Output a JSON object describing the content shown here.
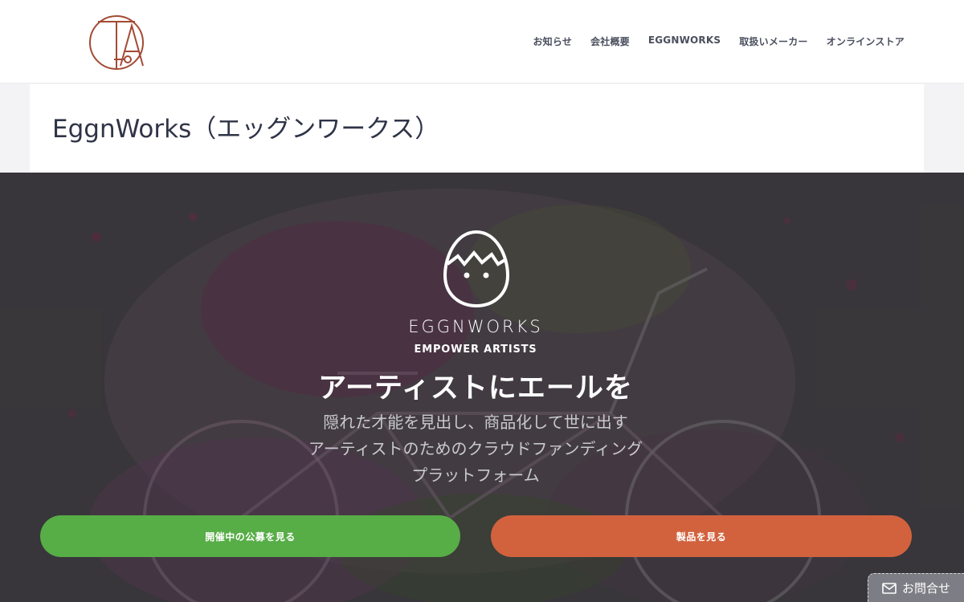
{
  "header": {
    "logo_icon": "ta-monogram-logo",
    "logo_color": "#a34a34",
    "nav": [
      {
        "label": "お知らせ"
      },
      {
        "label": "会社概要"
      },
      {
        "label": "EGGNWORKS"
      },
      {
        "label": "取扱いメーカー"
      },
      {
        "label": "オンラインストア"
      }
    ]
  },
  "page": {
    "title": "EggnWorks（エッグンワークス）"
  },
  "hero": {
    "background_icon": "watercolor-bicycle-image",
    "brand_icon": "cracked-egg-face-icon",
    "brand_name": "EGGNWORKS",
    "tagline": "EMPOWER ARTISTS",
    "heading": "アーティストにエールを",
    "description": [
      "隠れた才能を見出し、商品化して世に出す",
      "アーティストのためのクラウドファンディング",
      "プラットフォーム"
    ],
    "buttons": [
      {
        "label": "開催中の公募を見る",
        "color": "#57ad46"
      },
      {
        "label": "製品を見る",
        "color": "#d2623e"
      }
    ]
  },
  "contact": {
    "icon": "mail-icon",
    "label": "お問合せ"
  }
}
